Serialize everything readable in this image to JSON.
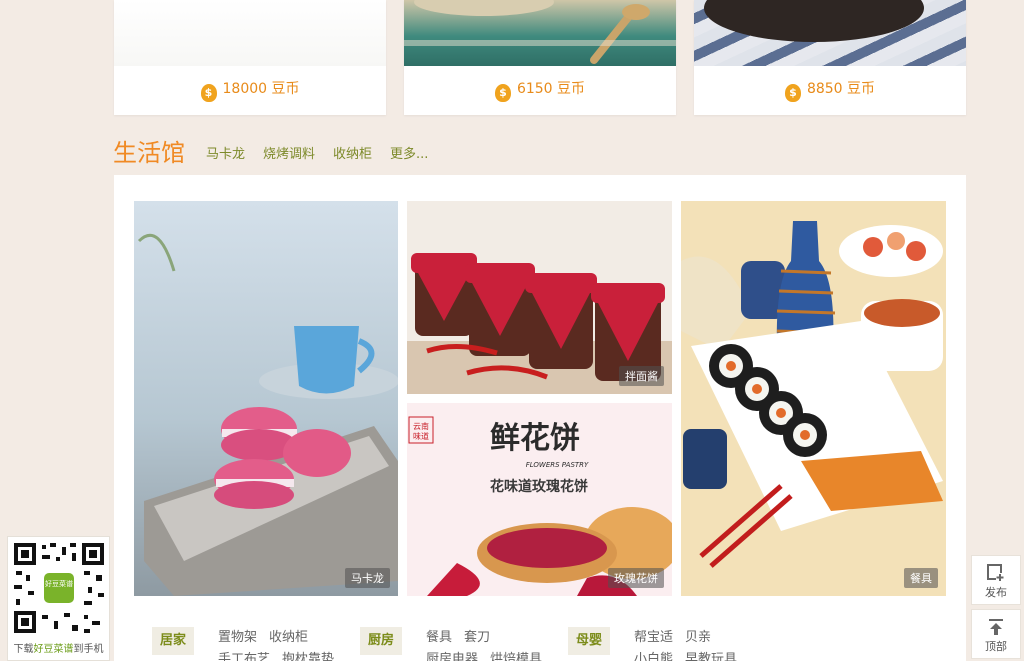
{
  "top_cards": [
    {
      "price": "18000",
      "unit": "豆币"
    },
    {
      "price": "6150",
      "unit": "豆币"
    },
    {
      "price": "8850",
      "unit": "豆币"
    }
  ],
  "section": {
    "title": "生活馆",
    "links": [
      "马卡龙",
      "烧烤调料",
      "收纳柜",
      "更多..."
    ]
  },
  "tiles": [
    {
      "label": "马卡龙"
    },
    {
      "label": "拌面酱"
    },
    {
      "label": "玫瑰花饼",
      "brand": "云南味道",
      "headline": "鲜花饼",
      "subheadline": "FLOWERS PASTRY",
      "caption": "花味道玫瑰花饼"
    },
    {
      "label": "餐具"
    }
  ],
  "categories": [
    {
      "tag": "居家",
      "row1": [
        "置物架",
        "收纳柜"
      ],
      "row2": [
        "手工布艺",
        "抱枕靠垫"
      ]
    },
    {
      "tag": "厨房",
      "row1": [
        "餐具",
        "套刀"
      ],
      "row2": [
        "厨房电器",
        "烘焙模具"
      ]
    },
    {
      "tag": "母婴",
      "row1": [
        "帮宝适",
        "贝亲"
      ],
      "row2": [
        "小白熊",
        "早教玩具"
      ]
    }
  ],
  "qr": {
    "prefix": "下载",
    "highlight": "好豆菜谱",
    "suffix": "到手机",
    "logo_text": "好豆菜谱"
  },
  "float_buttons": {
    "publish": "发布",
    "top": "顶部"
  }
}
